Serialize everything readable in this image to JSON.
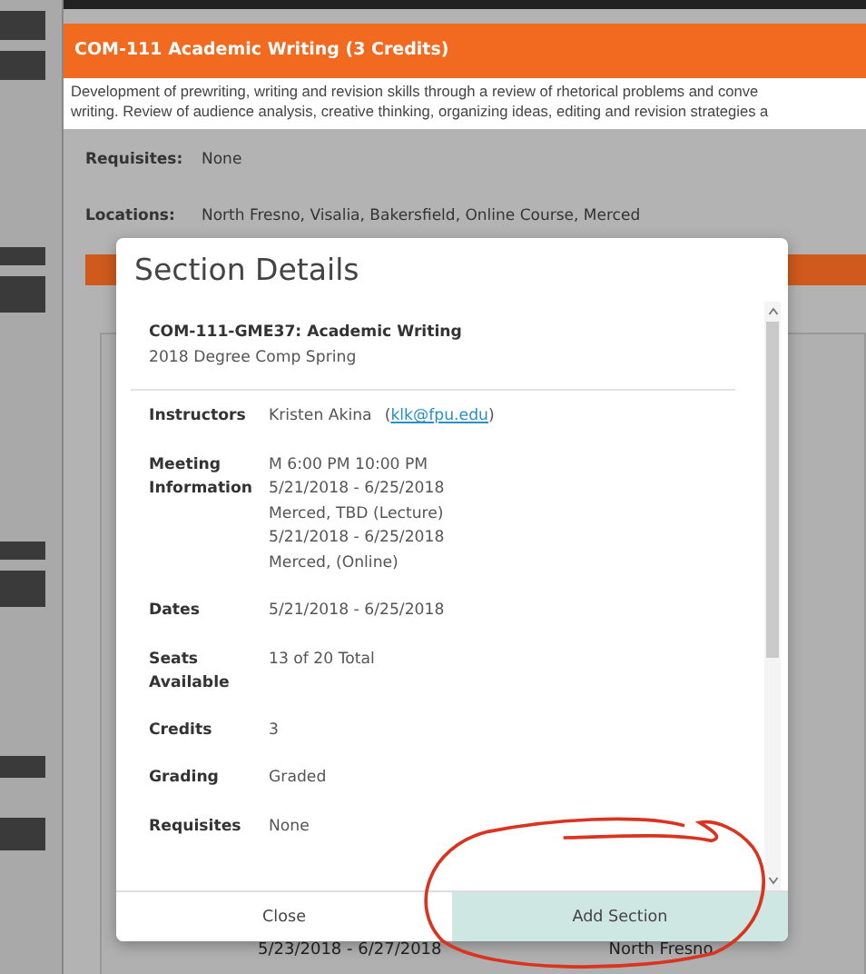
{
  "course": {
    "title": "COM-111 Academic Writing (3 Credits)",
    "description_lines": [
      "Development of prewriting, writing and revision skills through a review of rhetorical problems and conve",
      "writing. Review of audience analysis, creative thinking, organizing ideas, editing and revision strategies a"
    ],
    "fields": [
      {
        "label": "Requisites:",
        "value": "None"
      },
      {
        "label": "Locations:",
        "value": "North Fresno, Visalia, Bakersfield, Online Course, Merced"
      }
    ]
  },
  "background_row": {
    "dates": "5/23/2018 - 6/27/2018",
    "location": "North Fresno"
  },
  "modal": {
    "title": "Section Details",
    "section_title": "COM-111-GME37: Academic Writing",
    "term": "2018 Degree Comp Spring",
    "rows": [
      {
        "label": "Instructors",
        "lines": [
          "Kristen Akina"
        ],
        "link": "klk@fpu.edu",
        "link_open": "(",
        "link_close": ")"
      },
      {
        "label": "Meeting Information",
        "lines": [
          "M 6:00 PM 10:00 PM",
          "5/21/2018 - 6/25/2018",
          "Merced, TBD (Lecture)",
          "5/21/2018 - 6/25/2018",
          "Merced, (Online)"
        ]
      },
      {
        "label": "Dates",
        "lines": [
          "5/21/2018 - 6/25/2018"
        ]
      },
      {
        "label": "Seats Available",
        "lines": [
          "13 of 20 Total"
        ]
      },
      {
        "label": "Credits",
        "lines": [
          "3"
        ]
      },
      {
        "label": "Grading",
        "lines": [
          "Graded"
        ]
      },
      {
        "label": "Requisites",
        "lines": [
          "None"
        ]
      }
    ],
    "buttons": [
      {
        "label": "Close",
        "kind": "secondary"
      },
      {
        "label": "Add Section",
        "kind": "primary"
      }
    ]
  }
}
